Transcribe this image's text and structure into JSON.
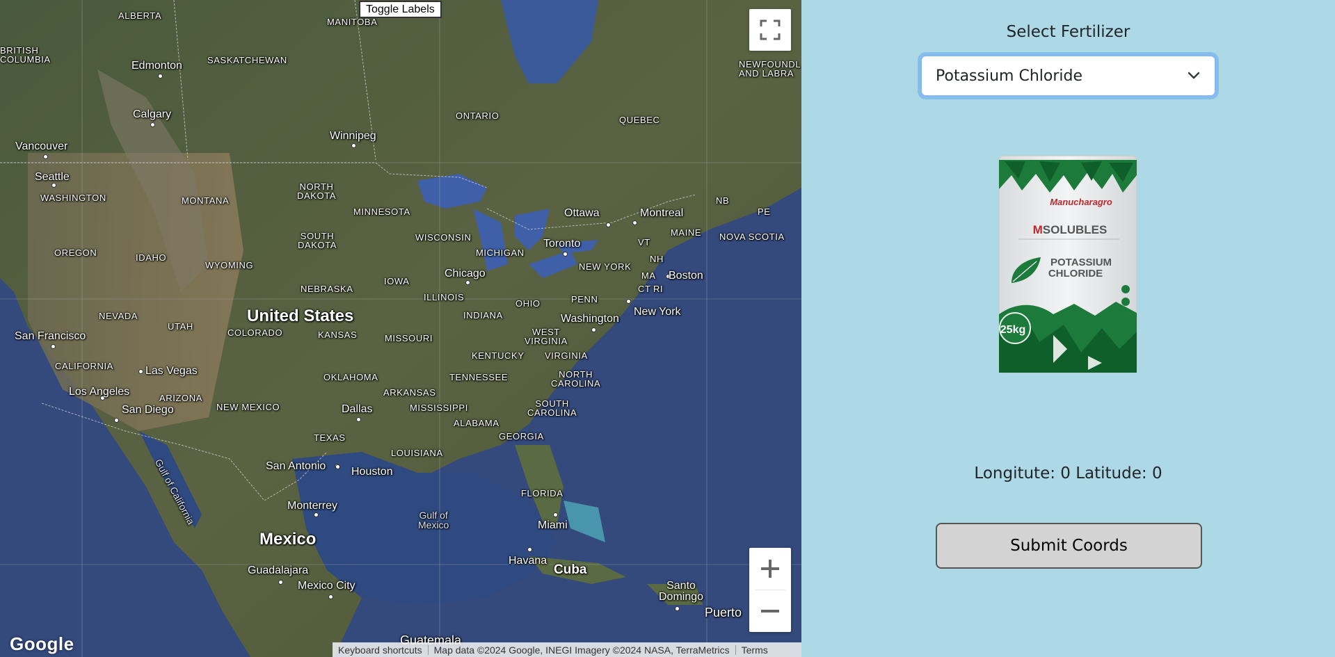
{
  "map": {
    "toggle_labels": "Toggle Labels",
    "logo": "Google",
    "attribution": {
      "keyboard": "Keyboard shortcuts",
      "map_data": "Map data ©2024 Google, INEGI Imagery ©2024 NASA, TerraMetrics",
      "terms": "Terms"
    },
    "labels": {
      "alberta": "ALBERTA",
      "manitoba": "MANITOBA",
      "british_columbia": "BRITISH\nCOLUMBIA",
      "saskatchewan": "SASKATCHEWAN",
      "edmonton": "Edmonton",
      "calgary": "Calgary",
      "vancouver": "Vancouver",
      "seattle": "Seattle",
      "washington_state": "WASHINGTON",
      "winnipeg": "Winnipeg",
      "ontario": "ONTARIO",
      "quebec": "QUEBEC",
      "newfoundland": "NEWFOUNDL\nAND LABRA",
      "montana": "MONTANA",
      "north_dakota": "NORTH\nDAKOTA",
      "minnesota": "MINNESOTA",
      "south_dakota": "SOUTH\nDAKOTA",
      "wisconsin": "WISCONSIN",
      "michigan": "MICHIGAN",
      "ottawa": "Ottawa",
      "montreal": "Montreal",
      "nb": "NB",
      "pe": "PE",
      "maine": "MAINE",
      "nova_scotia": "NOVA SCOTIA",
      "toronto": "Toronto",
      "vt": "VT",
      "nh": "NH",
      "new_york_state": "NEW YORK",
      "ma": "MA",
      "boston": "Boston",
      "ct": "CT",
      "ri": "RI",
      "oregon": "OREGON",
      "idaho": "IDAHO",
      "wyoming": "WYOMING",
      "nebraska": "NEBRASKA",
      "iowa": "IOWA",
      "chicago": "Chicago",
      "illinois": "ILLINOIS",
      "ohio": "OHIO",
      "penn": "PENN",
      "nevada": "NEVADA",
      "utah": "UTAH",
      "united_states": "United States",
      "colorado": "COLORADO",
      "kansas": "KANSAS",
      "missouri": "MISSOURI",
      "indiana": "INDIANA",
      "washington_dc": "Washington",
      "new_york": "New York",
      "west_virginia": "WEST\nVIRGINIA",
      "virginia": "VIRGINIA",
      "kentucky": "KENTUCKY",
      "san_francisco": "San Francisco",
      "california": "CALIFORNIA",
      "las_vegas": "Las Vegas",
      "los_angeles": "Los Angeles",
      "arizona": "ARIZONA",
      "san_diego": "San Diego",
      "new_mexico": "NEW MEXICO",
      "oklahoma": "OKLAHOMA",
      "tennessee": "TENNESSEE",
      "north_carolina": "NORTH\nCAROLINA",
      "arkansas": "ARKANSAS",
      "dallas": "Dallas",
      "mississippi": "MISSISSIPPI",
      "south_carolina": "SOUTH\nCAROLINA",
      "alabama": "ALABAMA",
      "georgia": "GEORGIA",
      "texas": "TEXAS",
      "louisiana": "LOUISIANA",
      "san_antonio": "San Antonio",
      "houston": "Houston",
      "florida": "FLORIDA",
      "gulf_of_california": "Gulf of California",
      "monterrey": "Monterrey",
      "gulf_of_mexico": "Gulf of\nMexico",
      "miami": "Miami",
      "mexico": "Mexico",
      "havana": "Havana",
      "cuba": "Cuba",
      "guadalajara": "Guadalajara",
      "mexico_city": "Mexico City",
      "santo_domingo": "Santo\nDomingo",
      "puerto": "Puerto",
      "guatemala": "Guatemala"
    }
  },
  "panel": {
    "select_title": "Select Fertilizer",
    "selected_fertilizer": "Potassium Chloride",
    "product": {
      "brand": "Manucharagro",
      "line": "SOLUBLES",
      "name_line1": "POTASSIUM",
      "name_line2": "CHLORIDE",
      "weight": "25kg"
    },
    "coords_text": "Longitute: 0 Latitude: 0",
    "submit_label": "Submit Coords"
  },
  "colors": {
    "panel_bg": "#add8e6",
    "select_focus": "#86b7fe",
    "button_bg": "#d3d3d3"
  }
}
